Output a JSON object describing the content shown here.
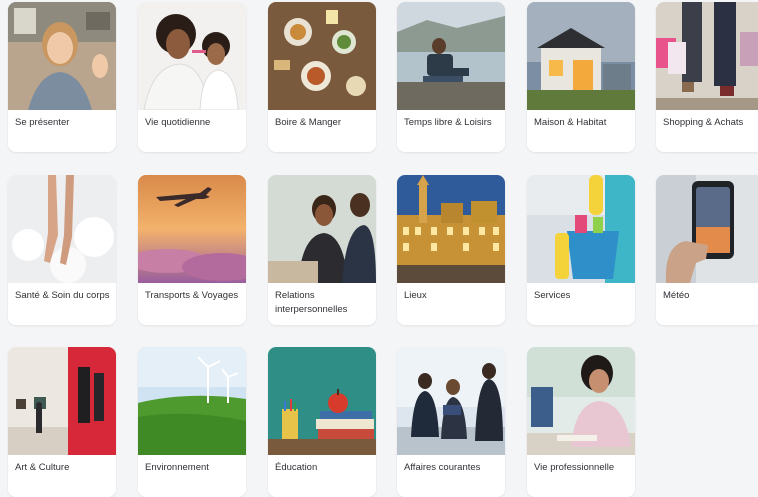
{
  "categories": [
    {
      "label": "Se présenter",
      "image": "woman-waving-image"
    },
    {
      "label": "Vie quotidienne",
      "image": "mother-daughter-toothbrush-image"
    },
    {
      "label": "Boire & Manger",
      "image": "dining-table-image"
    },
    {
      "label": "Temps libre & Loisirs",
      "image": "man-relaxing-lake-image"
    },
    {
      "label": "Maison & Habitat",
      "image": "modern-house-image"
    },
    {
      "label": "Shopping & Achats",
      "image": "shopping-bags-image"
    },
    {
      "label": "Santé & Soin du corps",
      "image": "bath-feet-image"
    },
    {
      "label": "Transports & Voyages",
      "image": "airplane-sunset-image"
    },
    {
      "label": "Relations interpersonnelles",
      "image": "people-talking-image"
    },
    {
      "label": "Lieux",
      "image": "grand-place-night-image"
    },
    {
      "label": "Services",
      "image": "cleaning-bucket-image"
    },
    {
      "label": "Météo",
      "image": "weather-phone-image"
    },
    {
      "label": "Art & Culture",
      "image": "art-gallery-image"
    },
    {
      "label": "Environnement",
      "image": "wind-turbines-image"
    },
    {
      "label": "Éducation",
      "image": "books-apple-image"
    },
    {
      "label": "Affaires courantes",
      "image": "business-meeting-image"
    },
    {
      "label": "Vie professionnelle",
      "image": "woman-working-desk-image"
    }
  ],
  "colors": {
    "background": "#f4f5f7",
    "card": "#ffffff",
    "text": "#2f3136"
  }
}
